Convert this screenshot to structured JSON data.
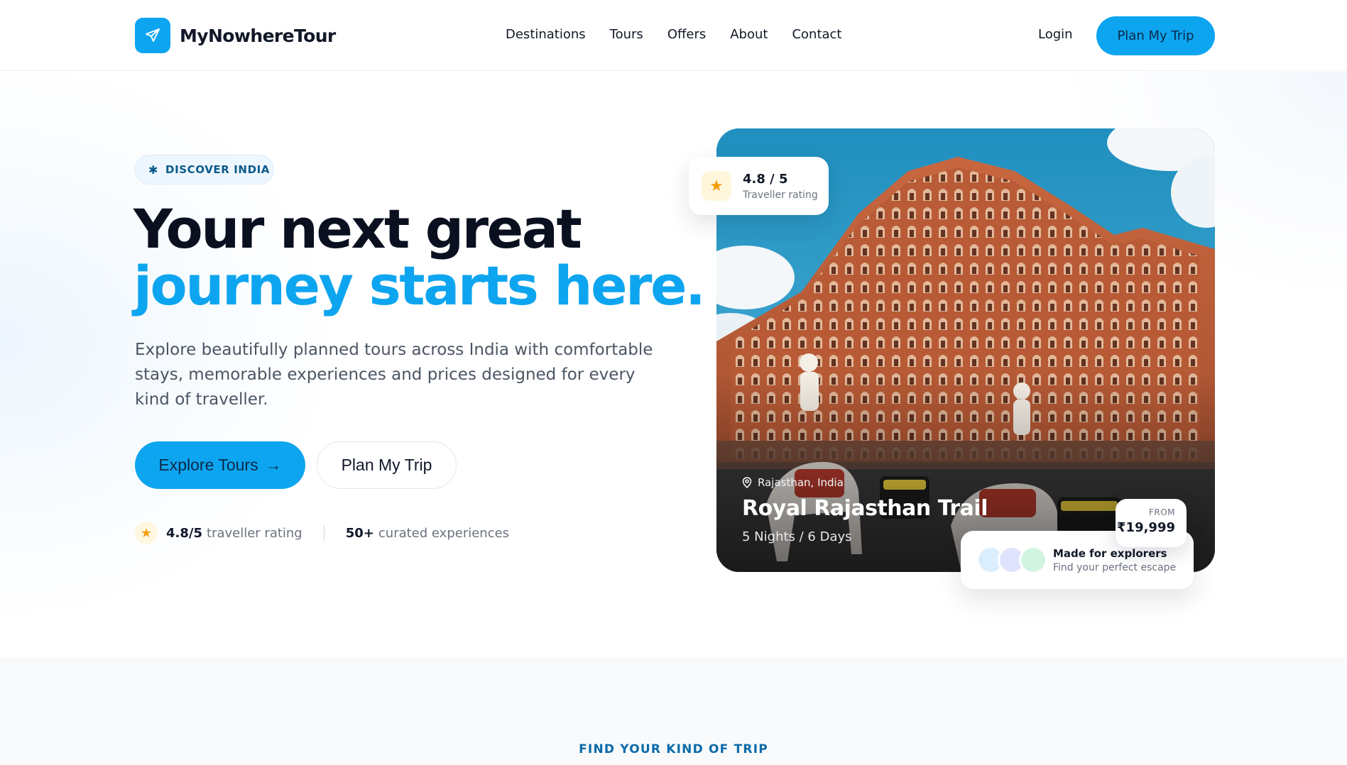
{
  "brand": {
    "name": "MyNowhereTour",
    "icon": "plane-icon",
    "accent": "#0ea5f0"
  },
  "nav": {
    "items": [
      "Destinations",
      "Tours",
      "Offers",
      "About",
      "Contact"
    ],
    "login": "Login",
    "cta": "Plan My Trip"
  },
  "hero": {
    "badge": "DISCOVER INDIA",
    "title_line1": "Your next great",
    "title_line2": "journey starts here.",
    "lead": "Explore beautifully planned tours across India with comfortable stays, memorable experiences and prices designed for every kind of traveller.",
    "primary_cta": "Explore Tours",
    "primary_cta_arrow": "→",
    "secondary_cta": "Plan My Trip",
    "stats": {
      "rating_value": "4.8/5",
      "rating_label": "traveller rating",
      "experiences_value": "50+",
      "experiences_label": "curated experiences"
    }
  },
  "feature_card": {
    "location": "Rajasthan, India",
    "title": "Royal Rajasthan Trail",
    "duration": "5 Nights / 6 Days",
    "rating_card": {
      "value": "4.8 / 5",
      "label": "Traveller rating"
    },
    "price": {
      "label": "FROM",
      "value": "₹19,999"
    },
    "explorers": {
      "title": "Made for explorers",
      "subtitle": "Find your perfect escape"
    }
  },
  "section_eyebrow": "FIND YOUR KIND OF TRIP"
}
